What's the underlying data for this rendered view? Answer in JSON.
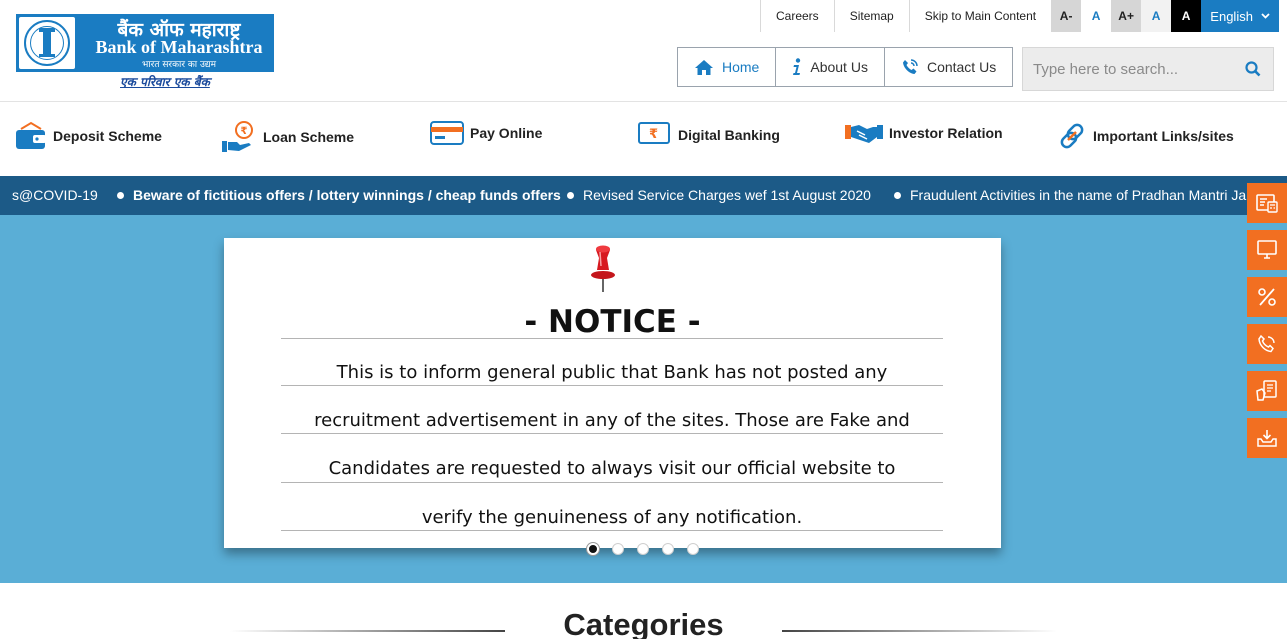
{
  "brand": {
    "name_hindi": "बैंक ऑफ महाराष्ट्र",
    "name_english": "Bank of Maharashtra",
    "subtitle_hindi": "भारत सरकार का उद्यम",
    "tagline_hindi": "एक परिवार एक बैंक",
    "brand_color": "#1a7cc2",
    "accent_color": "#f26f21"
  },
  "top_links": {
    "careers": "Careers",
    "sitemap": "Sitemap",
    "skip": "Skip to Main Content"
  },
  "font_size": {
    "decrease": "A-",
    "normal": "A",
    "increase": "A+",
    "contrast_blue": "A",
    "contrast_black": "A"
  },
  "language": {
    "selected": "English"
  },
  "main_nav": {
    "home": "Home",
    "about": "About Us",
    "contact": "Contact Us"
  },
  "search": {
    "placeholder": "Type here to search..."
  },
  "categories_nav": [
    {
      "label": "Deposit Scheme",
      "icon": "wallet-icon"
    },
    {
      "label": "Loan Scheme",
      "icon": "loan-hand-icon"
    },
    {
      "label": "Pay Online",
      "icon": "card-icon"
    },
    {
      "label": "Digital Banking",
      "icon": "rupee-screen-icon"
    },
    {
      "label": "Investor Relation",
      "icon": "handshake-icon"
    },
    {
      "label": "Important Links/sites",
      "icon": "link-icon"
    }
  ],
  "ticker": {
    "items": [
      {
        "text": "s@COVID-19",
        "bold": false
      },
      {
        "text": "Beware of fictitious offers / lottery winnings / cheap funds offers",
        "bold": true
      },
      {
        "text": "Revised Service Charges wef 1st August 2020",
        "bold": false
      },
      {
        "text": "Fraudulent Activities in the name of Pradhan Mantri Ja",
        "bold": false
      }
    ]
  },
  "notice": {
    "title": "- NOTICE -",
    "lines": [
      "This is to inform general public that Bank has not posted any",
      "recruitment advertisement in any of the sites. Those are Fake and",
      "Candidates are requested to always visit our official website to",
      "verify the genuineness of any notification."
    ]
  },
  "carousel": {
    "slide_count": 5,
    "active_index": 0
  },
  "side_buttons": [
    "calculator-form-icon",
    "desktop-icon",
    "percent-icon",
    "phone-icon",
    "document-hand-icon",
    "inbox-download-icon"
  ],
  "categories_section": {
    "heading": "Categories"
  }
}
